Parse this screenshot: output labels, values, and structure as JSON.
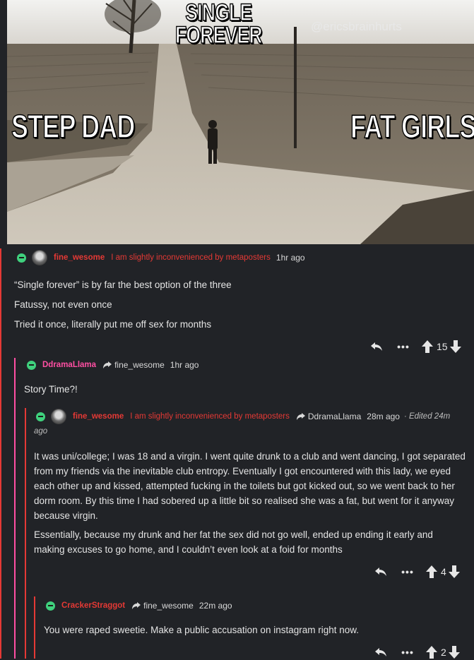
{
  "meme": {
    "top_label_line1": "SINGLE",
    "top_label_line2": "FOREVER",
    "left_label": "STEP DAD",
    "right_label": "FAT GIRLS",
    "watermark": "@ericsbrainhurts"
  },
  "comments": [
    {
      "username": "fine_wesome",
      "flair": "I am slightly inconvenienced by metaposters",
      "time": "1hr ago",
      "lines": [
        "“Single forever” is by far the best option of the three",
        "Fatussy, not even once",
        "Tried it once, literally put me off sex for months"
      ],
      "score": "15"
    },
    {
      "username": "DdramaLlama",
      "reply_to": "fine_wesome",
      "time": "1hr ago",
      "lines": [
        "Story Time?!"
      ]
    },
    {
      "username": "fine_wesome",
      "flair": "I am slightly inconvenienced by metaposters",
      "reply_to": "DdramaLlama",
      "time": "28m ago",
      "edited": "· Edited 24m",
      "edited_cont": "ago",
      "para1": "It was uni/college; I was 18 and a virgin. I went quite drunk to a club and went dancing, I got separated from my friends via the inevitable club entropy. Eventually I got encountered with this lady, we eyed each other up and kissed, attempted fucking in the toilets but got kicked out, so we went back to her dorm room. By this time I had sobered up a little bit so realised she was a fat, but went for it anyway because virgin.",
      "para2": "Essentially, because my drunk and her fat the sex did not go well, ended up ending it early and making excuses to go home, and I couldn’t even look at a foid for months",
      "score": "4"
    },
    {
      "username": "CrackerStraggot",
      "reply_to": "fine_wesome",
      "time": "22m ago",
      "lines": [
        "You were raped sweetie. Make a public accusation on instagram right now."
      ],
      "score": "2"
    }
  ],
  "icons": {
    "reply": "reply-arrow-icon",
    "more": "more-dots-icon",
    "upvote": "upvote-arrow-icon",
    "downvote": "downvote-arrow-icon",
    "collapse": "collapse-minus-icon"
  },
  "colors": {
    "background": "#212327",
    "thread_bar": "#e53935",
    "pink_bar": "#ff4fa3",
    "collapse_green": "#3fd17d",
    "flair_red": "#e53935"
  }
}
